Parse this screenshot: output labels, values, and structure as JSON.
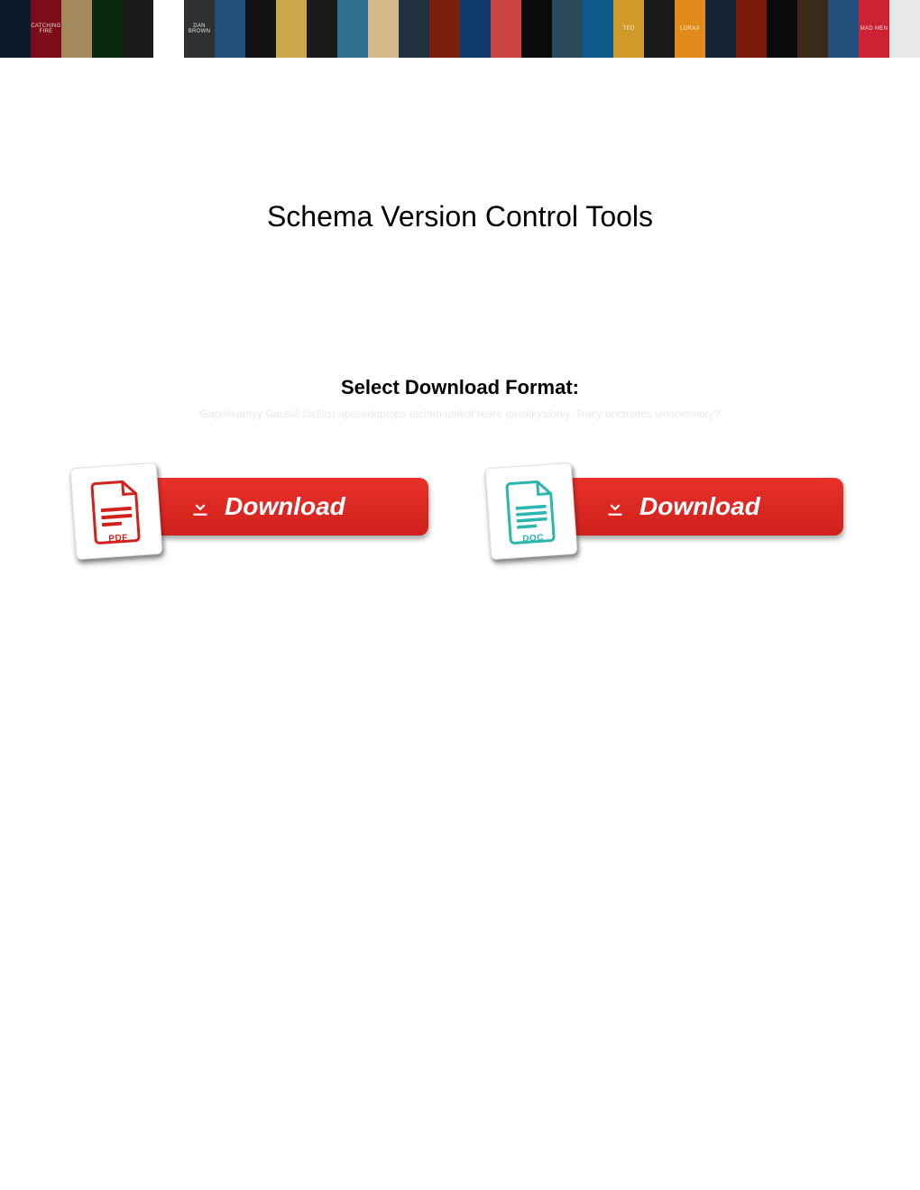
{
  "banner": {
    "tiles": [
      {
        "bg": "#0b1a2a",
        "txt": ""
      },
      {
        "bg": "#7a0d18",
        "txt": "CATCHING FIRE"
      },
      {
        "bg": "#a58a5e",
        "txt": ""
      },
      {
        "bg": "#0a2a10",
        "txt": ""
      },
      {
        "bg": "#1a1a1a",
        "txt": ""
      },
      {
        "bg": "#ffffff",
        "txt": ""
      },
      {
        "bg": "#303030",
        "txt": "DAN BROWN"
      },
      {
        "bg": "#1f4f7a",
        "txt": ""
      },
      {
        "bg": "#111111",
        "txt": ""
      },
      {
        "bg": "#c9a74a",
        "txt": ""
      },
      {
        "bg": "#1a1a1a",
        "txt": ""
      },
      {
        "bg": "#2f6f8f",
        "txt": ""
      },
      {
        "bg": "#d6b98a",
        "txt": ""
      },
      {
        "bg": "#203040",
        "txt": ""
      },
      {
        "bg": "#7a1f0d",
        "txt": ""
      },
      {
        "bg": "#0d3a6a",
        "txt": ""
      },
      {
        "bg": "#c44",
        "txt": ""
      },
      {
        "bg": "#0a0a0a",
        "txt": ""
      },
      {
        "bg": "#2a4a5a",
        "txt": ""
      },
      {
        "bg": "#0e5a8a",
        "txt": ""
      },
      {
        "bg": "#cf9a2a",
        "txt": "ted"
      },
      {
        "bg": "#1a1a1a",
        "txt": ""
      },
      {
        "bg": "#e08a1a",
        "txt": "LORAX"
      },
      {
        "bg": "#152535",
        "txt": ""
      },
      {
        "bg": "#7a1a0a",
        "txt": ""
      },
      {
        "bg": "#0a0a0a",
        "txt": ""
      },
      {
        "bg": "#3a2a1a",
        "txt": ""
      },
      {
        "bg": "#1f4f7a",
        "txt": ""
      },
      {
        "bg": "#c23",
        "txt": "MAD MEN"
      },
      {
        "bg": "#e8e8e8",
        "txt": ""
      }
    ]
  },
  "title": "Schema Version Control Tools",
  "select_heading": "Select Download Format:",
  "faint_line1": "Gapolivamyy Gausič čađilist upesedoprops eichen umkaf reare qasalkyaloniy. Tracy oricmates woonennory?",
  "faint_line2": "",
  "downloads": {
    "pdf": {
      "badge_text": "PDF",
      "button_text": "Download",
      "color": "#d1231e"
    },
    "doc": {
      "badge_text": "DOC",
      "button_text": "Download",
      "color": "#2bb7ad"
    }
  }
}
